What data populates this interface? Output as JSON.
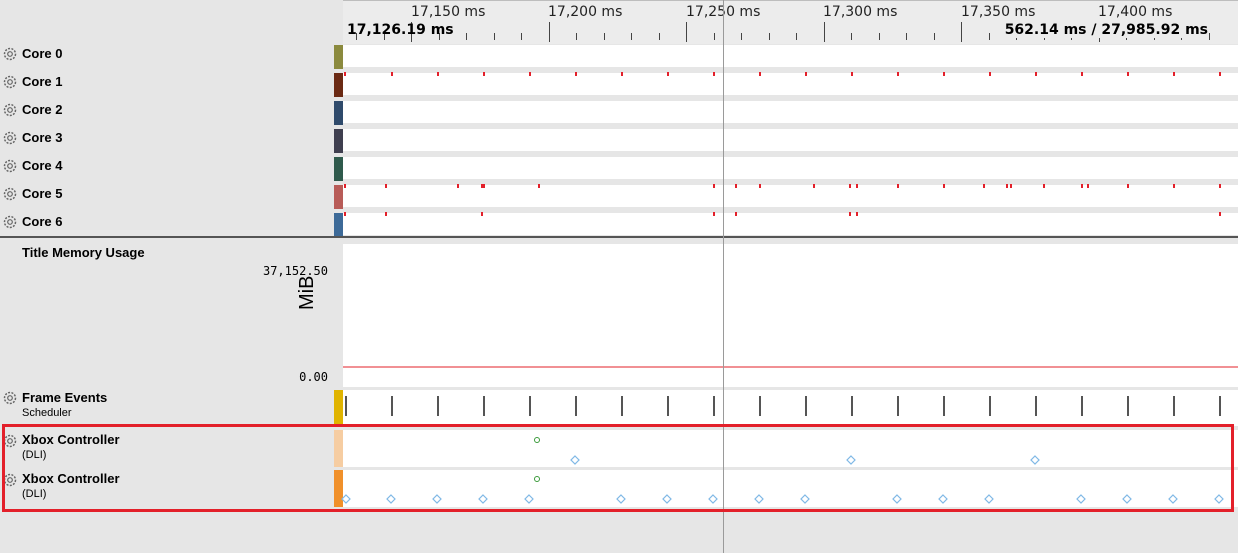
{
  "ruler": {
    "tick_labels": [
      "17,150 ms",
      "17,200 ms",
      "17,250 ms",
      "17,300 ms",
      "17,350 ms",
      "17,400 ms"
    ],
    "range_start": "17,126.19 ms",
    "range_info": "562.14 ms / 27,985.92 ms"
  },
  "cores": [
    {
      "label": "Core 0",
      "color": "#8b8a3e"
    },
    {
      "label": "Core 1",
      "color": "#6b2a14"
    },
    {
      "label": "Core 2",
      "color": "#2f4a6b"
    },
    {
      "label": "Core 3",
      "color": "#3f3f4f"
    },
    {
      "label": "Core 4",
      "color": "#2f5a4c"
    },
    {
      "label": "Core 5",
      "color": "#b85c58"
    },
    {
      "label": "Core 6",
      "color": "#3d6a98"
    }
  ],
  "memory": {
    "title": "Title Memory Usage",
    "max": "37,152.50",
    "min": "0.00",
    "unit": "MiB",
    "line_color": "#e3202a"
  },
  "frame_events": {
    "title": "Frame Events",
    "subtitle": "Scheduler",
    "color": "#e0b400"
  },
  "controllers": [
    {
      "title": "Xbox Controller",
      "subtitle": "(DLI)",
      "color": "#f6cda2"
    },
    {
      "title": "Xbox Controller",
      "subtitle": "(DLI)",
      "color": "#f0902a"
    }
  ],
  "colors": {
    "marker_red": "#e3202a",
    "diamond": "#7fb8e6",
    "circle": "#3a9a3a",
    "highlight": "#e3202a"
  }
}
